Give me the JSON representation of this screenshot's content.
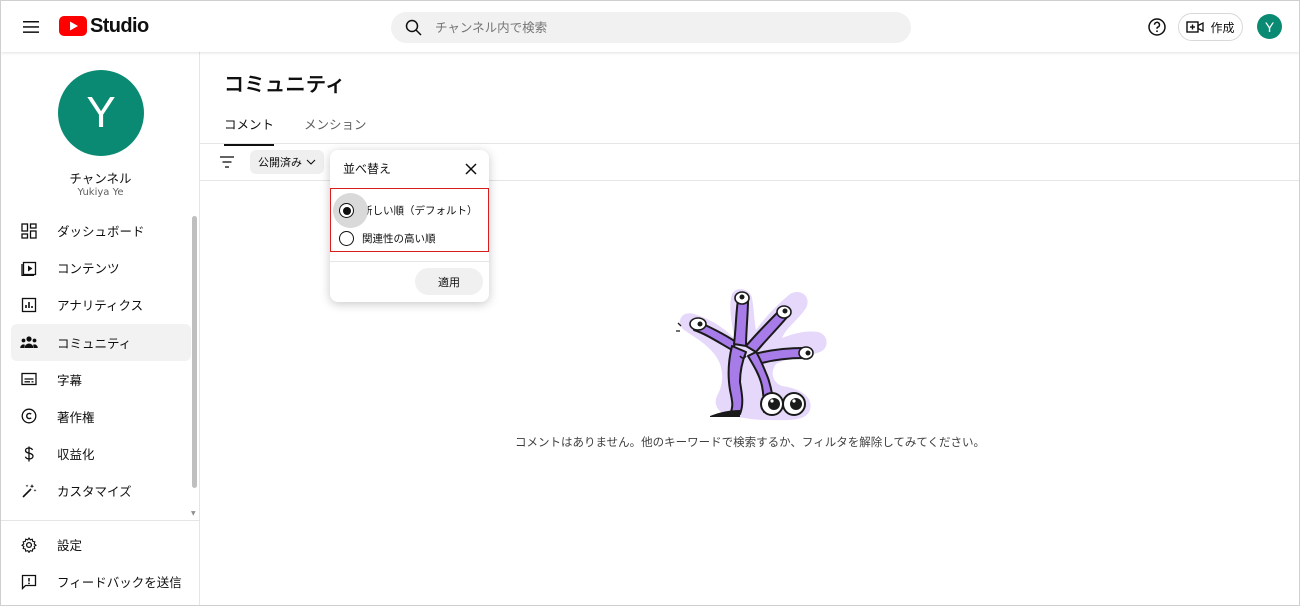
{
  "header": {
    "logo_text": "Studio",
    "search_placeholder": "チャンネル内で検索",
    "create_label": "作成",
    "avatar_letter": "Y"
  },
  "sidebar": {
    "avatar_letter": "Y",
    "channel_title": "チャンネル",
    "channel_name": "Yukiya Ye",
    "items": [
      {
        "label": "ダッシュボード",
        "icon": "dashboard-icon"
      },
      {
        "label": "コンテンツ",
        "icon": "content-icon"
      },
      {
        "label": "アナリティクス",
        "icon": "analytics-icon"
      },
      {
        "label": "コミュニティ",
        "icon": "community-icon",
        "active": true
      },
      {
        "label": "字幕",
        "icon": "subtitles-icon"
      },
      {
        "label": "著作権",
        "icon": "copyright-icon"
      },
      {
        "label": "収益化",
        "icon": "dollar-icon"
      },
      {
        "label": "カスタマイズ",
        "icon": "magic-wand-icon"
      }
    ],
    "bottom_items": [
      {
        "label": "設定",
        "icon": "gear-icon"
      },
      {
        "label": "フィードバックを送信",
        "icon": "feedback-icon"
      }
    ]
  },
  "main": {
    "title": "コミュニティ",
    "tabs": [
      {
        "label": "コメント",
        "active": true
      },
      {
        "label": "メンション",
        "active": false
      }
    ],
    "filter_chip": "公開済み",
    "empty_message": "コメントはありません。他のキーワードで検索するか、フィルタを解除してみてください。"
  },
  "sort_popup": {
    "title": "並べ替え",
    "options": [
      {
        "label": "新しい順（デフォルト）",
        "selected": true
      },
      {
        "label": "関連性の高い順",
        "selected": false
      }
    ],
    "apply_label": "適用"
  },
  "colors": {
    "brand_red": "#ff0000",
    "avatar_green": "#0b8a73",
    "highlight_border": "#d91c1c",
    "illustration_purple": "#a77be8"
  }
}
